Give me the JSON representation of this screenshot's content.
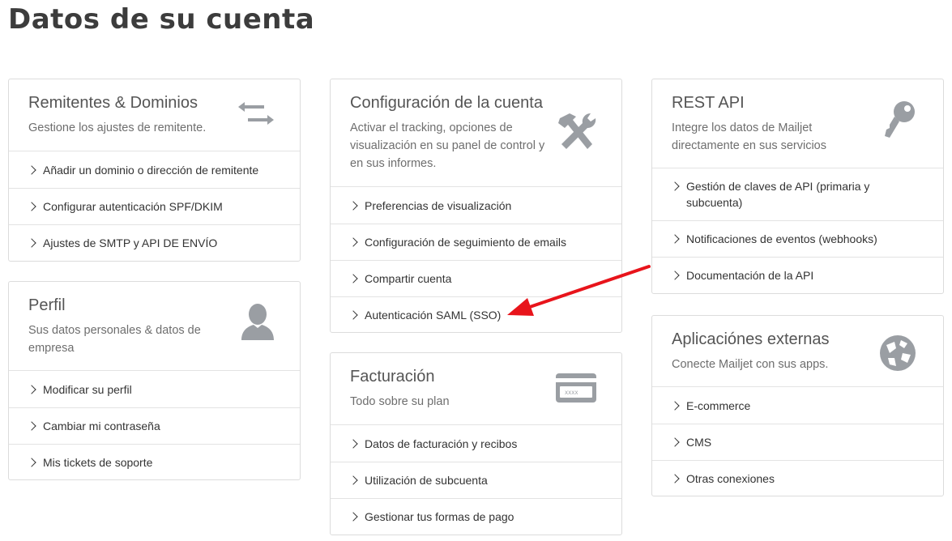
{
  "page": {
    "title": "Datos de su cuenta"
  },
  "colors": {
    "accent_arrow": "#e8141b",
    "icon_gray": "#9a9ea3"
  },
  "cards": {
    "senders": {
      "title": "Remitentes & Dominios",
      "subtitle": "Gestione los ajustes de remitente.",
      "icon": "swap-arrows-icon",
      "links": [
        "Añadir un dominio o dirección de remitente",
        "Configurar autenticación SPF/DKIM",
        "Ajustes de SMTP y API DE ENVÍO"
      ]
    },
    "profile": {
      "title": "Perfil",
      "subtitle": "Sus datos personales & datos de empresa",
      "icon": "user-icon",
      "links": [
        "Modificar su perfil",
        "Cambiar mi contraseña",
        "Mis tickets de soporte"
      ]
    },
    "account": {
      "title": "Configuración de la cuenta",
      "subtitle": "Activar el tracking, opciones de visualización en su panel de control y en sus informes.",
      "icon": "tools-icon",
      "links": [
        "Preferencias de visualización",
        "Configuración de seguimiento de emails",
        "Compartir cuenta",
        "Autenticación SAML (SSO)"
      ]
    },
    "billing": {
      "title": "Facturación",
      "subtitle": "Todo sobre su plan",
      "icon": "credit-card-icon",
      "card_label": "XXXX",
      "links": [
        "Datos de facturación y recibos",
        "Utilización de subcuenta",
        "Gestionar tus formas de pago"
      ]
    },
    "api": {
      "title": "REST API",
      "subtitle": "Integre los datos de Mailjet directamente en sus servicios",
      "icon": "key-icon",
      "links": [
        "Gestión de claves de API (primaria y subcuenta)",
        "Notificaciones de eventos (webhooks)",
        "Documentación de la API"
      ]
    },
    "apps": {
      "title": "Aplicaciónes externas",
      "subtitle": "Conecte Mailjet con sus apps.",
      "icon": "globe-icon",
      "links": [
        "E-commerce",
        "CMS",
        "Otras conexiones"
      ]
    }
  }
}
